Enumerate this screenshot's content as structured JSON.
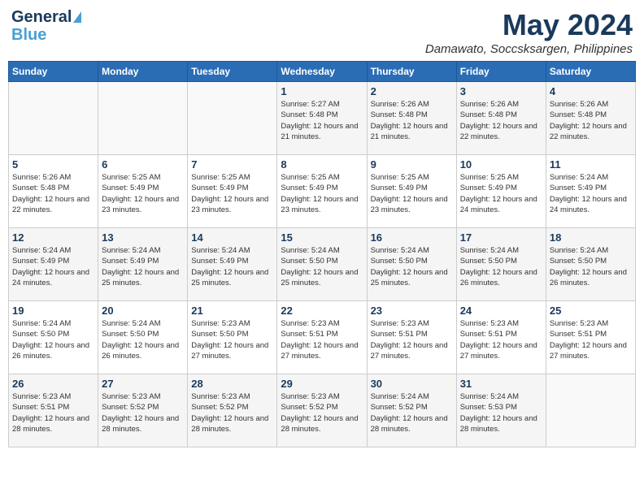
{
  "header": {
    "logo_line1": "General",
    "logo_line2": "Blue",
    "month": "May 2024",
    "location": "Damawato, Soccsksargen, Philippines"
  },
  "weekdays": [
    "Sunday",
    "Monday",
    "Tuesday",
    "Wednesday",
    "Thursday",
    "Friday",
    "Saturday"
  ],
  "weeks": [
    [
      {
        "day": "",
        "info": ""
      },
      {
        "day": "",
        "info": ""
      },
      {
        "day": "",
        "info": ""
      },
      {
        "day": "1",
        "info": "Sunrise: 5:27 AM\nSunset: 5:48 PM\nDaylight: 12 hours\nand 21 minutes."
      },
      {
        "day": "2",
        "info": "Sunrise: 5:26 AM\nSunset: 5:48 PM\nDaylight: 12 hours\nand 21 minutes."
      },
      {
        "day": "3",
        "info": "Sunrise: 5:26 AM\nSunset: 5:48 PM\nDaylight: 12 hours\nand 22 minutes."
      },
      {
        "day": "4",
        "info": "Sunrise: 5:26 AM\nSunset: 5:48 PM\nDaylight: 12 hours\nand 22 minutes."
      }
    ],
    [
      {
        "day": "5",
        "info": "Sunrise: 5:26 AM\nSunset: 5:48 PM\nDaylight: 12 hours\nand 22 minutes."
      },
      {
        "day": "6",
        "info": "Sunrise: 5:25 AM\nSunset: 5:49 PM\nDaylight: 12 hours\nand 23 minutes."
      },
      {
        "day": "7",
        "info": "Sunrise: 5:25 AM\nSunset: 5:49 PM\nDaylight: 12 hours\nand 23 minutes."
      },
      {
        "day": "8",
        "info": "Sunrise: 5:25 AM\nSunset: 5:49 PM\nDaylight: 12 hours\nand 23 minutes."
      },
      {
        "day": "9",
        "info": "Sunrise: 5:25 AM\nSunset: 5:49 PM\nDaylight: 12 hours\nand 23 minutes."
      },
      {
        "day": "10",
        "info": "Sunrise: 5:25 AM\nSunset: 5:49 PM\nDaylight: 12 hours\nand 24 minutes."
      },
      {
        "day": "11",
        "info": "Sunrise: 5:24 AM\nSunset: 5:49 PM\nDaylight: 12 hours\nand 24 minutes."
      }
    ],
    [
      {
        "day": "12",
        "info": "Sunrise: 5:24 AM\nSunset: 5:49 PM\nDaylight: 12 hours\nand 24 minutes."
      },
      {
        "day": "13",
        "info": "Sunrise: 5:24 AM\nSunset: 5:49 PM\nDaylight: 12 hours\nand 25 minutes."
      },
      {
        "day": "14",
        "info": "Sunrise: 5:24 AM\nSunset: 5:49 PM\nDaylight: 12 hours\nand 25 minutes."
      },
      {
        "day": "15",
        "info": "Sunrise: 5:24 AM\nSunset: 5:50 PM\nDaylight: 12 hours\nand 25 minutes."
      },
      {
        "day": "16",
        "info": "Sunrise: 5:24 AM\nSunset: 5:50 PM\nDaylight: 12 hours\nand 25 minutes."
      },
      {
        "day": "17",
        "info": "Sunrise: 5:24 AM\nSunset: 5:50 PM\nDaylight: 12 hours\nand 26 minutes."
      },
      {
        "day": "18",
        "info": "Sunrise: 5:24 AM\nSunset: 5:50 PM\nDaylight: 12 hours\nand 26 minutes."
      }
    ],
    [
      {
        "day": "19",
        "info": "Sunrise: 5:24 AM\nSunset: 5:50 PM\nDaylight: 12 hours\nand 26 minutes."
      },
      {
        "day": "20",
        "info": "Sunrise: 5:24 AM\nSunset: 5:50 PM\nDaylight: 12 hours\nand 26 minutes."
      },
      {
        "day": "21",
        "info": "Sunrise: 5:23 AM\nSunset: 5:50 PM\nDaylight: 12 hours\nand 27 minutes."
      },
      {
        "day": "22",
        "info": "Sunrise: 5:23 AM\nSunset: 5:51 PM\nDaylight: 12 hours\nand 27 minutes."
      },
      {
        "day": "23",
        "info": "Sunrise: 5:23 AM\nSunset: 5:51 PM\nDaylight: 12 hours\nand 27 minutes."
      },
      {
        "day": "24",
        "info": "Sunrise: 5:23 AM\nSunset: 5:51 PM\nDaylight: 12 hours\nand 27 minutes."
      },
      {
        "day": "25",
        "info": "Sunrise: 5:23 AM\nSunset: 5:51 PM\nDaylight: 12 hours\nand 27 minutes."
      }
    ],
    [
      {
        "day": "26",
        "info": "Sunrise: 5:23 AM\nSunset: 5:51 PM\nDaylight: 12 hours\nand 28 minutes."
      },
      {
        "day": "27",
        "info": "Sunrise: 5:23 AM\nSunset: 5:52 PM\nDaylight: 12 hours\nand 28 minutes."
      },
      {
        "day": "28",
        "info": "Sunrise: 5:23 AM\nSunset: 5:52 PM\nDaylight: 12 hours\nand 28 minutes."
      },
      {
        "day": "29",
        "info": "Sunrise: 5:23 AM\nSunset: 5:52 PM\nDaylight: 12 hours\nand 28 minutes."
      },
      {
        "day": "30",
        "info": "Sunrise: 5:24 AM\nSunset: 5:52 PM\nDaylight: 12 hours\nand 28 minutes."
      },
      {
        "day": "31",
        "info": "Sunrise: 5:24 AM\nSunset: 5:53 PM\nDaylight: 12 hours\nand 28 minutes."
      },
      {
        "day": "",
        "info": ""
      }
    ]
  ]
}
